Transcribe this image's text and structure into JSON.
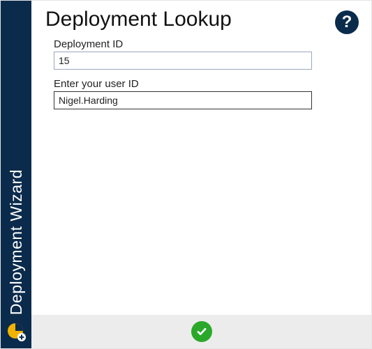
{
  "sidebar": {
    "title": "Deployment Wizard"
  },
  "header": {
    "title": "Deployment Lookup"
  },
  "form": {
    "deployment_id": {
      "label": "Deployment ID",
      "value": "15"
    },
    "user_id": {
      "label": "Enter your user ID",
      "value": "Nigel.Harding"
    }
  }
}
